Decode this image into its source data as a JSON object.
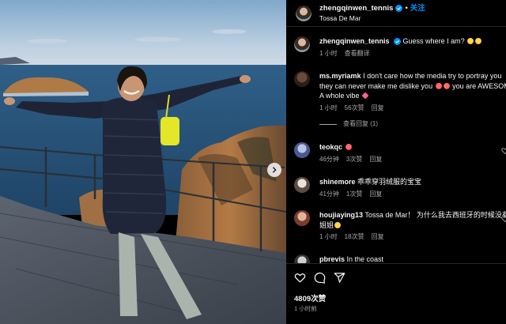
{
  "post": {
    "author": "zhengqinwen_tennis",
    "location": "Tossa De Mar",
    "follow_label": "关注",
    "separator": "•"
  },
  "caption": {
    "username": "zhengqinwen_tennis",
    "text": "Guess where I am?",
    "time": "1 小时",
    "translate": "查看翻译"
  },
  "comments": [
    {
      "username": "ms.myriamk",
      "text_line1": "I don't care how the media try to portray you",
      "text_line2_a": "they can never make me dislike you",
      "text_line2_b": "you are AWESOME",
      "text_line3": "A whole vibe",
      "time": "1 小时",
      "likes": "56次赞",
      "reply": "回复",
      "view_replies": "查看回复 (1)"
    },
    {
      "username": "teokqc",
      "text": "",
      "time": "46分钟",
      "likes": "3次赞",
      "reply": "回复"
    },
    {
      "username": "shinemore",
      "text": "乖乖穿羽绒服的宝宝",
      "time": "41分钟",
      "likes": "1次赞",
      "reply": "回复"
    },
    {
      "username": "houjiaying13",
      "text_line1": "Tossa de Mar！ 为什么我去西班牙的时候没有",
      "text_line2": "姐姐",
      "time": "1 小时",
      "likes": "18次赞",
      "reply": "回复"
    },
    {
      "username": "pbrevis",
      "text": "In the coast"
    }
  ],
  "footer": {
    "likes": "4809次赞",
    "time": "1 小时前"
  },
  "colors": {
    "accent": "#0095f6",
    "background": "#000000",
    "muted": "#a8a8a8",
    "text": "#f5f5f5"
  },
  "icons": [
    "verified-badge-icon",
    "heart-icon",
    "comment-icon",
    "share-icon",
    "chevron-right-icon"
  ]
}
